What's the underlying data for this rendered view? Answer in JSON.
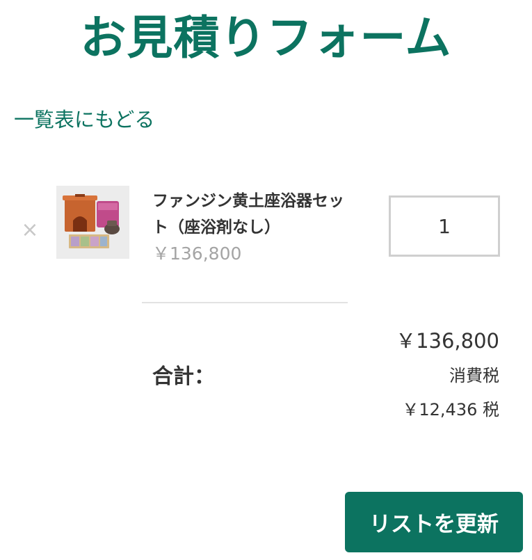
{
  "page": {
    "title": "お見積りフォーム",
    "back_link": "一覧表にもどる"
  },
  "cart": {
    "items": [
      {
        "remove_symbol": "×",
        "name": "ファンジン黄土座浴器セット（座浴剤なし）",
        "price": "￥136,800",
        "quantity": "1"
      }
    ]
  },
  "totals": {
    "label": "合計：",
    "amount": "￥136,800",
    "tax_label": "消費税",
    "tax_line": "￥12,436 税"
  },
  "actions": {
    "update_label": "リストを更新"
  },
  "colors": {
    "accent": "#0c7360",
    "muted_text": "#a4a4a4",
    "border": "#cfcfcf"
  }
}
